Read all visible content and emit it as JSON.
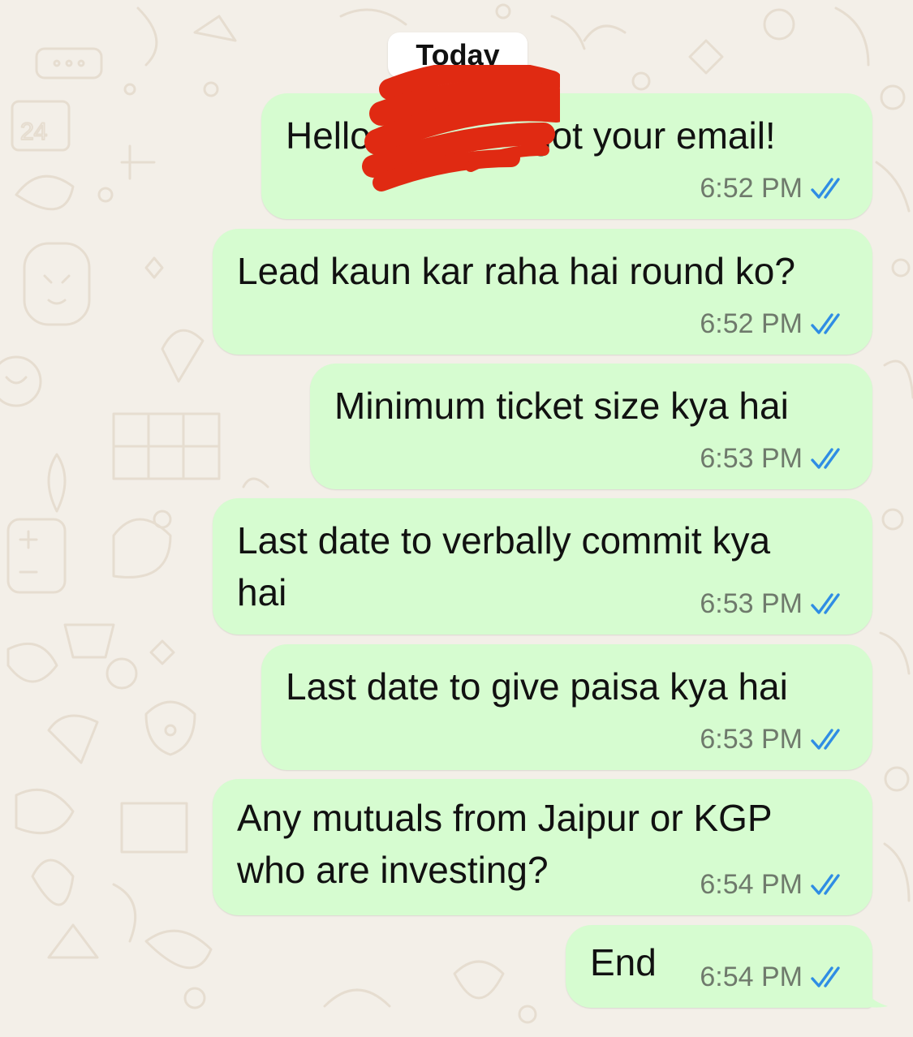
{
  "date_separator": "Today",
  "messages": [
    {
      "segments": [
        "Hello",
        "got your email!"
      ],
      "time": "6:52 PM",
      "status": "read"
    },
    {
      "text": "Lead kaun kar raha hai round ko?",
      "time": "6:52 PM",
      "status": "read"
    },
    {
      "text": "Minimum ticket size kya hai",
      "time": "6:53 PM",
      "status": "read"
    },
    {
      "lines": [
        "Last date to verbally commit kya",
        "hai"
      ],
      "time": "6:53 PM",
      "status": "read"
    },
    {
      "text": "Last date to give paisa kya hai",
      "time": "6:53 PM",
      "status": "read"
    },
    {
      "lines": [
        "Any mutuals from Jaipur or KGP",
        "who are investing?"
      ],
      "time": "6:54 PM",
      "status": "read"
    },
    {
      "text": "End",
      "time": "6:54 PM",
      "status": "read"
    }
  ],
  "colors": {
    "outgoing_bubble": "#d6fcd0",
    "read_ticks": "#2f8de4",
    "wallpaper": "#f3efe8",
    "redaction": "#e02a12"
  },
  "icons": {
    "read_receipt": "double-check-icon"
  }
}
